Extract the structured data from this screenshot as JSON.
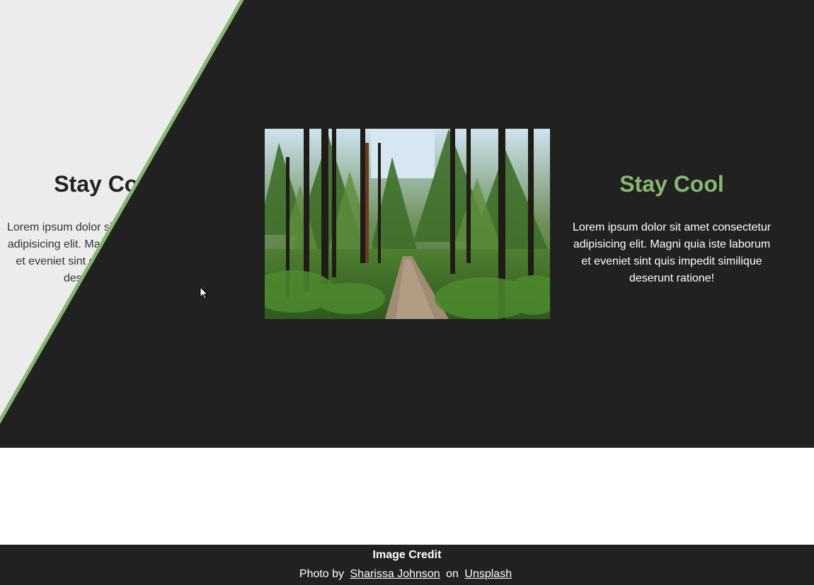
{
  "hero": {
    "left": {
      "title": "Stay Cool",
      "body": "Lorem ipsum dolor sit amet consectetur adipisicing elit. Magni quia iste laborum et eveniet sint quis impedit similique deserunt ratione!"
    },
    "right": {
      "title": "Stay Cool",
      "body": "Lorem ipsum dolor sit amet consectetur adipisicing elit. Magni quia iste laborum et eveniet sint quis impedit similique deserunt ratione!"
    },
    "image_icon": "forest-path-photo"
  },
  "colors": {
    "dark": "#212121",
    "light": "#ececec",
    "accent": "#88b673"
  },
  "footer": {
    "title": "Image Credit",
    "prefix": "Photo by",
    "author": "Sharissa Johnson",
    "middle": "on",
    "site": "Unsplash"
  }
}
